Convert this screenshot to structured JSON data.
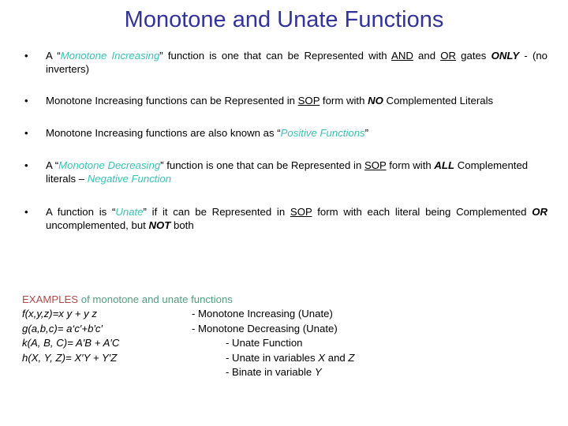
{
  "slide": {
    "title": "Monotone and Unate Functions",
    "title_color": "#333399",
    "background_color": "#ffffff",
    "accent_teal": "#3cbfb4",
    "examples_keyword_color": "#b04a4a",
    "examples_rest_color": "#4f9e7f",
    "bullet_glyph": "•"
  },
  "bullets": [
    {
      "id": "bullet-1",
      "runs": [
        {
          "text": "A “",
          "style": "plain"
        },
        {
          "text": "Monotone Increasing",
          "style": "teal-italic"
        },
        {
          "text": "” function is one that can be Represented with ",
          "style": "plain"
        },
        {
          "text": "AND",
          "style": "underline"
        },
        {
          "text": " and ",
          "style": "plain"
        },
        {
          "text": "OR",
          "style": "underline"
        },
        {
          "text": " gates ",
          "style": "plain"
        },
        {
          "text": "ONLY",
          "style": "bold-italic"
        },
        {
          "text": " - (no inverters)",
          "style": "plain"
        }
      ],
      "plain_text": "A “Monotone Increasing” function is one that can be Represented with AND and OR gates ONLY - (no inverters)"
    },
    {
      "id": "bullet-2",
      "runs": [
        {
          "text": "Monotone Increasing functions can be Represented in ",
          "style": "plain"
        },
        {
          "text": "SOP",
          "style": "underline"
        },
        {
          "text": " form with ",
          "style": "plain"
        },
        {
          "text": "NO",
          "style": "bold-italic"
        },
        {
          "text": " Complemented Literals",
          "style": "plain"
        }
      ],
      "plain_text": "Monotone Increasing functions can be Represented in SOP form with NO Complemented Literals"
    },
    {
      "id": "bullet-3",
      "runs": [
        {
          "text": "Monotone Increasing functions are also known as “",
          "style": "plain"
        },
        {
          "text": "Positive Functions",
          "style": "teal-italic"
        },
        {
          "text": "”",
          "style": "plain"
        }
      ],
      "plain_text": "Monotone Increasing functions are also known as “Positive Functions”"
    },
    {
      "id": "bullet-4",
      "runs": [
        {
          "text": "A “",
          "style": "plain"
        },
        {
          "text": "Monotone Decreasing",
          "style": "teal-italic"
        },
        {
          "text": "” function is one that can be Represented in ",
          "style": "plain"
        },
        {
          "text": "SOP",
          "style": "underline"
        },
        {
          "text": " form with ",
          "style": "plain"
        },
        {
          "text": "ALL",
          "style": "bold-italic"
        },
        {
          "text": " Complemented literals – ",
          "style": "plain"
        },
        {
          "text": "Negative Function",
          "style": "teal-italic"
        }
      ],
      "plain_text": "A “Monotone Decreasing” function is one that can be Represented in SOP form with ALL Complemented literals – Negative Function"
    },
    {
      "id": "bullet-5",
      "runs": [
        {
          "text": "A function is “",
          "style": "plain"
        },
        {
          "text": "Unate",
          "style": "teal-italic"
        },
        {
          "text": "” if it can be Represented in ",
          "style": "plain"
        },
        {
          "text": "SOP",
          "style": "underline"
        },
        {
          "text": " form with each literal being Complemented ",
          "style": "plain"
        },
        {
          "text": "OR",
          "style": "bold-italic"
        },
        {
          "text": " uncomplemented, but ",
          "style": "plain"
        },
        {
          "text": "NOT",
          "style": "bold-italic"
        },
        {
          "text": " both",
          "style": "plain"
        }
      ],
      "plain_text": "A function is “Unate” if it can be Represented in SOP form with each literal being Complemented OR uncomplemented, but NOT both"
    }
  ],
  "examples": {
    "heading_keyword": "EXAMPLES",
    "heading_rest": " of monotone and unate functions",
    "rows": [
      {
        "formula": "f(x,y,z)=x y + y z",
        "note_prefix": "- Monotone Increasing (Unate)",
        "note_col": "a"
      },
      {
        "formula": "g(a,b,c)= a‘c′+b′c′",
        "note_prefix": "- Monotone Decreasing (Unate)",
        "note_col": "a"
      },
      {
        "formula": "k(A, B, C)= A′B + A′C",
        "note_prefix": "- Unate Function",
        "note_col": "b"
      },
      {
        "formula": "h(X, Y, Z)= X′Y + Y′Z",
        "note_prefix": "- Unate in variables ",
        "note_var1": "X",
        "note_mid": " and ",
        "note_var2": "Z",
        "note_col": "b"
      },
      {
        "formula": "",
        "note_prefix": "- Binate in variable ",
        "note_var1": "Y",
        "note_col": "b"
      }
    ]
  }
}
